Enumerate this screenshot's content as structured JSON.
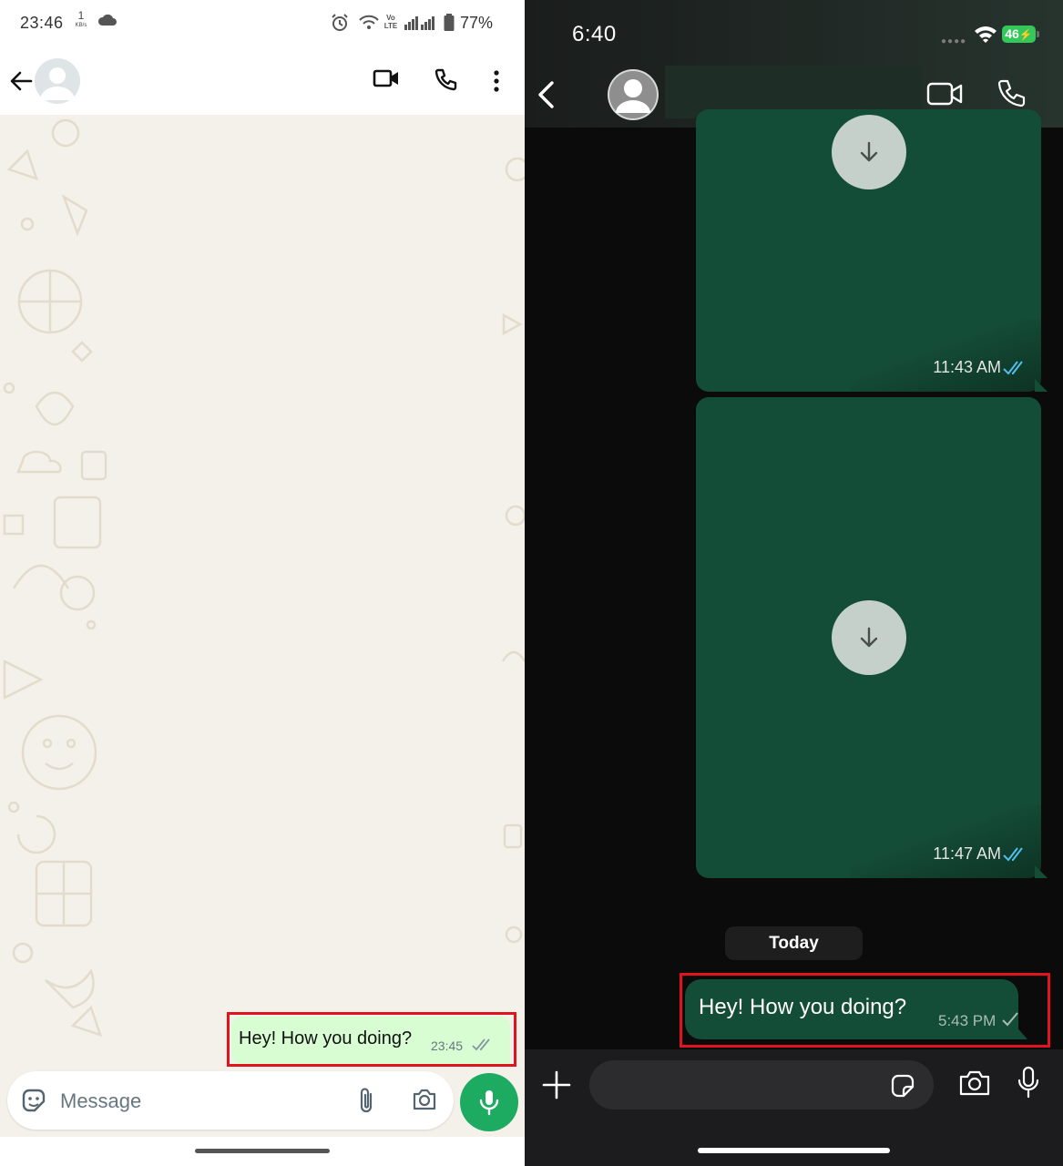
{
  "android": {
    "status": {
      "time": "23:46",
      "netspeed_value": "1",
      "netspeed_unit": "KB/s",
      "network_label": "Vo LTE",
      "battery": "77%"
    },
    "header": {
      "back_label": "Back",
      "contact_name": ""
    },
    "message": {
      "text": "Hey! How you doing?",
      "time": "23:45",
      "status_icon": "double-check-icon"
    },
    "composer": {
      "placeholder": "Message"
    },
    "colors": {
      "chat_bg": "#f4f1ea",
      "outgoing_bubble": "#d9fdd3",
      "mic_button": "#1daa61",
      "highlight": "#e0141e"
    }
  },
  "ios": {
    "status": {
      "time": "6:40",
      "battery": "46"
    },
    "messages": [
      {
        "type": "media",
        "time": "11:43 AM",
        "status_icon": "double-check-icon"
      },
      {
        "type": "media",
        "time": "11:47 AM",
        "status_icon": "double-check-icon"
      }
    ],
    "date_separator": "Today",
    "last_message": {
      "text": "Hey! How you doing?",
      "time": "5:43 PM",
      "status_icon": "single-check-icon"
    },
    "colors": {
      "chat_bg": "#0b0b0b",
      "outgoing_bubble": "#144d37",
      "battery": "#34c759",
      "read_ticks": "#53bdeb",
      "highlight": "#e0141e"
    }
  }
}
